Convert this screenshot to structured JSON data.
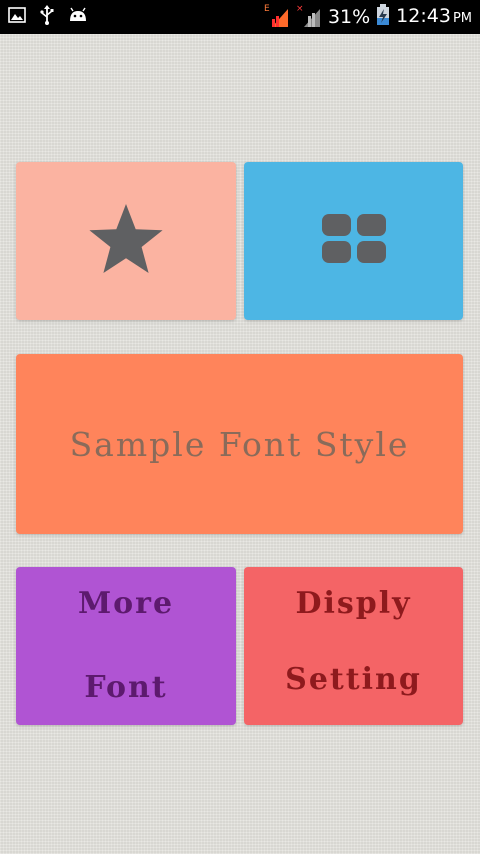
{
  "status_bar": {
    "signal_1_label": "E",
    "signal_2_label": "×",
    "battery_percent": "31%",
    "time": "12:43",
    "time_suffix": "PM"
  },
  "tiles": {
    "favorite": {
      "icon": "star-icon",
      "color": "#fbb3a1"
    },
    "collection": {
      "icon": "grid-icon",
      "color": "#4db6e4"
    },
    "sample": {
      "text": "Sample Font Style",
      "color": "#ff845b",
      "text_color": "#8a6b5a"
    },
    "more_font": {
      "line1": "More",
      "line2": "Font",
      "color": "#b054d3",
      "text_color": "#5d1a6e"
    },
    "display_setting": {
      "line1": "Disply",
      "line2": "Setting",
      "color": "#f46466",
      "text_color": "#8e1a1d"
    }
  },
  "colors": {
    "icon_gray": "#5f6062"
  }
}
